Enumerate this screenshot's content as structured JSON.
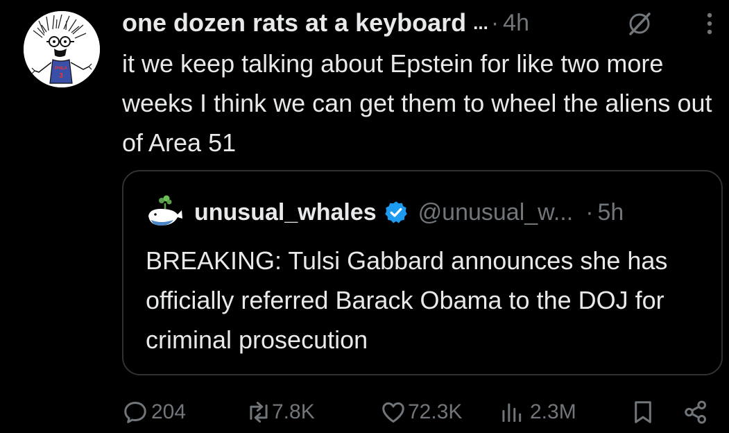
{
  "tweet": {
    "display_name": "one dozen rats at a keyboard",
    "name_truncation": "...",
    "separator": "·",
    "time": "4h",
    "text": "it we keep talking about Epstein for like two more weeks I think we can get them to wheel the aliens out of Area 51",
    "avatar_jersey_text": "PHILA",
    "avatar_jersey_number": "3"
  },
  "quote": {
    "display_name": "unusual_whales",
    "handle": "@unusual_w...",
    "separator": "·",
    "time": "5h",
    "text": "BREAKING: Tulsi Gabbard announces she has officially referred Barack Obama to the DOJ for criminal prosecution"
  },
  "actions": {
    "replies": "204",
    "reposts": "7.8K",
    "likes": "72.3K",
    "views": "2.3M"
  },
  "colors": {
    "background": "#000000",
    "text_primary": "#e7e9ea",
    "text_secondary": "#71767b",
    "border": "#2f3336",
    "verified_blue": "#1d9bf0"
  },
  "icons": {
    "grok": "grok-icon",
    "more": "more-icon",
    "verified": "verified-icon",
    "reply": "reply-icon",
    "repost": "repost-icon",
    "like": "like-icon",
    "views": "views-icon",
    "bookmark": "bookmark-icon",
    "share": "share-icon"
  }
}
